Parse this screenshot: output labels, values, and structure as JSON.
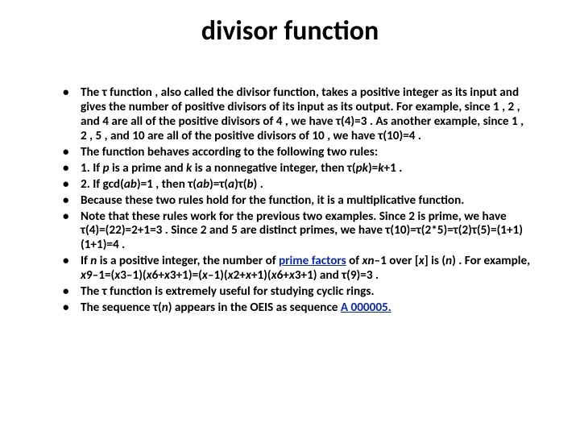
{
  "title": "divisor function",
  "bullets": [
    "The  τ function , also called the divisor function, takes a positive integer as its input and gives the number of positive divisors of its input as its output. For example, since 1 , 2 , and 4 are all of the positive divisors of 4 , we have τ(4)=3 . As another example, since 1 , 2 , 5 , and 10 are all of the positive divisors of 10 , we have τ(10)=4 .",
    "The  function behaves according to the following two rules:",
    "1. If <span class=\"i\">p</span> is a prime and <span class=\"i\">k</span> is a nonnegative integer, then τ(<span class=\"i\">pk</span>)=<span class=\"i\">k</span>+1 .",
    "2. If gcd(<span class=\"i\">ab</span>)=1 , then τ(<span class=\"i\">ab</span>)=τ(<span class=\"i\">a</span>)τ(<span class=\"i\">b</span>) .",
    "Because these two rules hold for the  function, it is a multiplicative function.",
    "Note that these rules work for the previous two examples. Since 2 is prime, we have τ(4)=(22)=2+1=3 . Since 2 and 5 are distinct primes, we have τ(10)=τ(2*5)=τ(2)τ(5)=(1+1)(1+1)=4 .",
    "If <span class=\"i\">n</span> is a positive integer, the number of <span class=\"link\">prime factors</span> of <span class=\"i\">xn</span>–1 over [<span class=\"i\">x</span>] is (<span class=\"i\">n</span>) . For example, <span class=\"i\">x</span>9–1=(<span class=\"i\">x</span>3–1)(<span class=\"i\">x</span>6+<span class=\"i\">x</span>3+1)=(<span class=\"i\">x</span>–1)(<span class=\"i\">x</span>2+<span class=\"i\">x</span>+1)(<span class=\"i\">x</span>6+<span class=\"i\">x</span>3+1) and τ(9)=3 .",
    "The  τ function is extremely useful for studying cyclic rings.",
    "The sequence τ(<span class=\"i\">n</span>) appears in the OEIS as sequence <span class=\"link\">A 000005.</span>"
  ]
}
